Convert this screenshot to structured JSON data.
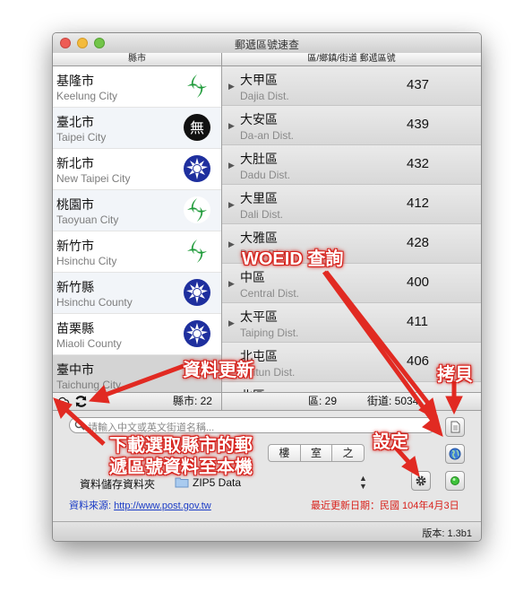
{
  "window": {
    "title": "郵遞區號速查"
  },
  "headers": {
    "city": "縣市",
    "district": "區/鄉鎮/街道 郵遞區號"
  },
  "cities": [
    {
      "zh": "基隆市",
      "en": "Keelung City",
      "emblem": "green-leaf-emblem-icon"
    },
    {
      "zh": "臺北市",
      "en": "Taipei City",
      "emblem": "black-wu-emblem-icon"
    },
    {
      "zh": "新北市",
      "en": "New Taipei City",
      "emblem": "blue-sun-emblem-icon"
    },
    {
      "zh": "桃園市",
      "en": "Taoyuan City",
      "emblem": "green-leaf-emblem-icon"
    },
    {
      "zh": "新竹市",
      "en": "Hsinchu City",
      "emblem": "green-leaf-emblem-icon"
    },
    {
      "zh": "新竹縣",
      "en": "Hsinchu County",
      "emblem": "blue-sun-emblem-icon"
    },
    {
      "zh": "苗栗縣",
      "en": "Miaoli County",
      "emblem": "blue-sun-emblem-icon"
    },
    {
      "zh": "臺中市",
      "en": "Taichung City",
      "emblem": "none"
    }
  ],
  "districts": [
    {
      "zh": "大甲區",
      "en": "Dajia Dist.",
      "zip": "437"
    },
    {
      "zh": "大安區",
      "en": "Da-an Dist.",
      "zip": "439"
    },
    {
      "zh": "大肚區",
      "en": "Dadu Dist.",
      "zip": "432"
    },
    {
      "zh": "大里區",
      "en": "Dali Dist.",
      "zip": "412"
    },
    {
      "zh": "大雅區",
      "en": "Daya Dist.",
      "zip": "428"
    },
    {
      "zh": "中區",
      "en": "Central Dist.",
      "zip": "400"
    },
    {
      "zh": "太平區",
      "en": "Taiping Dist.",
      "zip": "411"
    },
    {
      "zh": "北屯區",
      "en": "Beitun Dist.",
      "zip": "406"
    },
    {
      "zh": "北區",
      "en": "",
      "zip": ""
    }
  ],
  "status": {
    "city_count": "縣市: 22",
    "district_count": "區: 29",
    "street_count": "街道: 5034"
  },
  "search": {
    "placeholder": "請輸入中文或英文街道名稱..."
  },
  "segment": {
    "items": [
      "樓",
      "室",
      "之"
    ]
  },
  "folder": {
    "label": "資料儲存資料夾",
    "value": "ZIP5 Data"
  },
  "source": {
    "prefix": "資料來源: ",
    "url": "http://www.post.gov.tw"
  },
  "updated": {
    "text": "最近更新日期：民國 104年4月3日"
  },
  "version": {
    "text": "版本: 1.3b1"
  },
  "annotations": {
    "woeid": "WOEID 查詢",
    "refresh": "資料更新",
    "copy": "拷貝",
    "settings": "設定",
    "download_line1": "下載選取縣市的郵",
    "download_line2": "遞區號資料至本機"
  },
  "colors": {
    "annotation": "#d6221c",
    "link": "#1b3cc6",
    "updated": "#d9211b",
    "selected_row": "#d4d4d4"
  }
}
